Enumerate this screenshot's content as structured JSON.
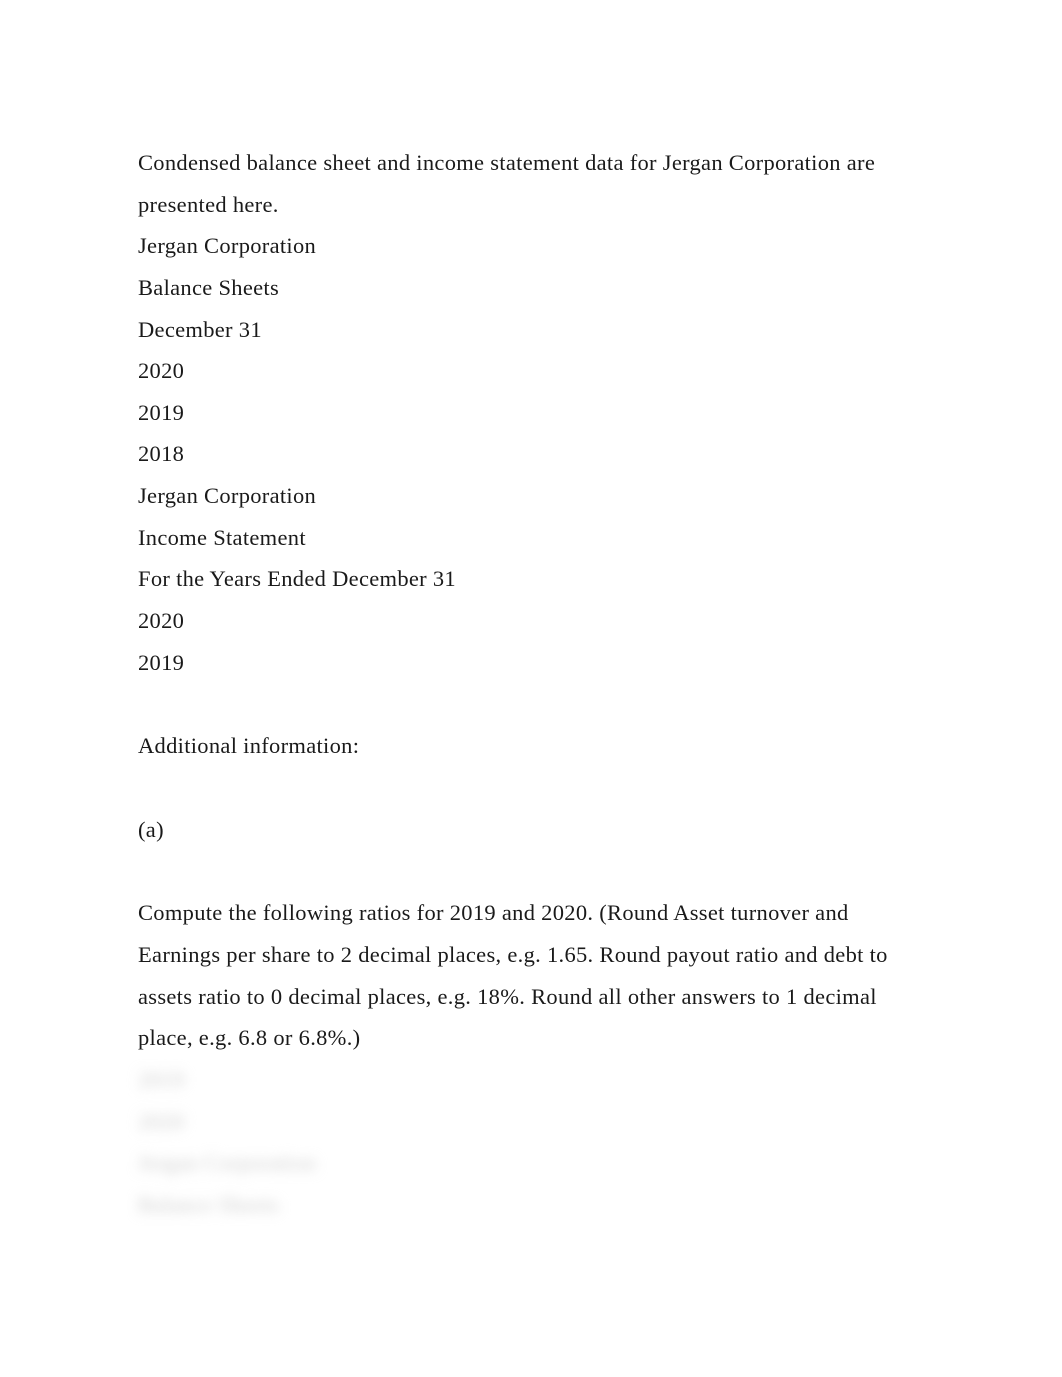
{
  "intro": "Condensed balance sheet and income statement data for Jergan Corporation are presented here.",
  "balance_sheet": {
    "company": "Jergan Corporation",
    "title": "Balance Sheets",
    "date_label": " December 31",
    "years": [
      "2020",
      "2019",
      "2018"
    ]
  },
  "income_statement": {
    "company": "Jergan Corporation",
    "title": "Income Statement",
    "period_label": " For the Years Ended December 31",
    "years": [
      "2020",
      "2019"
    ]
  },
  "additional_info_label": " Additional information:",
  "part_label": "(a)",
  "instructions": " Compute the following ratios for 2019 and 2020. (Round Asset turnover and Earnings per share to 2 decimal places, e.g. 1.65. Round payout ratio and debt to assets ratio to 0 decimal places, e.g. 18%. Round all other answers to 1 decimal place, e.g. 6.8 or 6.8%.)",
  "blurred": {
    "line1": "2019",
    "line2": "2020",
    "line3": "Jergan Corporation",
    "line4": "Balance Sheets"
  }
}
